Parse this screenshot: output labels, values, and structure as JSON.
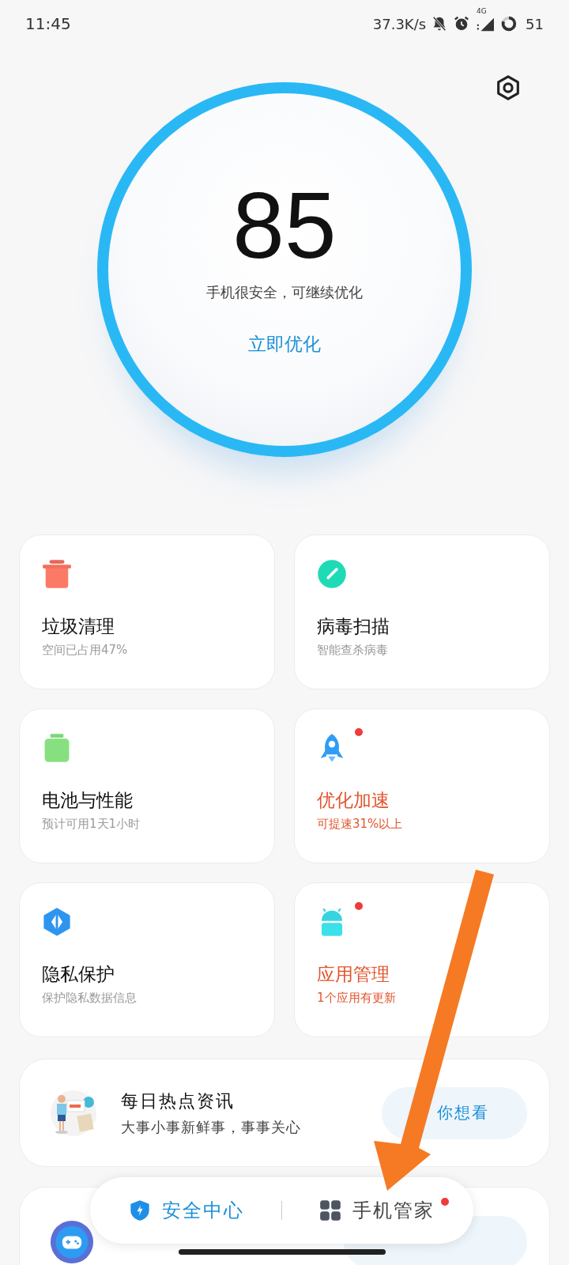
{
  "status_bar": {
    "time": "11:45",
    "net_speed": "37.3K/s",
    "network": "4G",
    "battery": "51"
  },
  "score": {
    "value": "85",
    "message": "手机很安全，可继续优化",
    "action": "立即优化"
  },
  "tiles": [
    {
      "title": "垃圾清理",
      "subtitle": "空间已占用47%",
      "alert": false
    },
    {
      "title": "病毒扫描",
      "subtitle": "智能查杀病毒",
      "alert": false
    },
    {
      "title": "电池与性能",
      "subtitle": "预计可用1天1小时",
      "alert": false
    },
    {
      "title": "优化加速",
      "subtitle": "可提速31%以上",
      "alert": true
    },
    {
      "title": "隐私保护",
      "subtitle": "保护隐私数据信息",
      "alert": false
    },
    {
      "title": "应用管理",
      "subtitle": "1个应用有更新",
      "alert": true
    }
  ],
  "news_card": {
    "kind": "picture",
    "title": "每日热点资讯",
    "subtitle": "大事小事新鲜事，事事关心",
    "button": "你想看"
  },
  "bottom_nav": [
    {
      "label": "安全中心",
      "selected": true,
      "badge": false
    },
    {
      "label": "手机管家",
      "selected": false,
      "badge": true
    }
  ]
}
